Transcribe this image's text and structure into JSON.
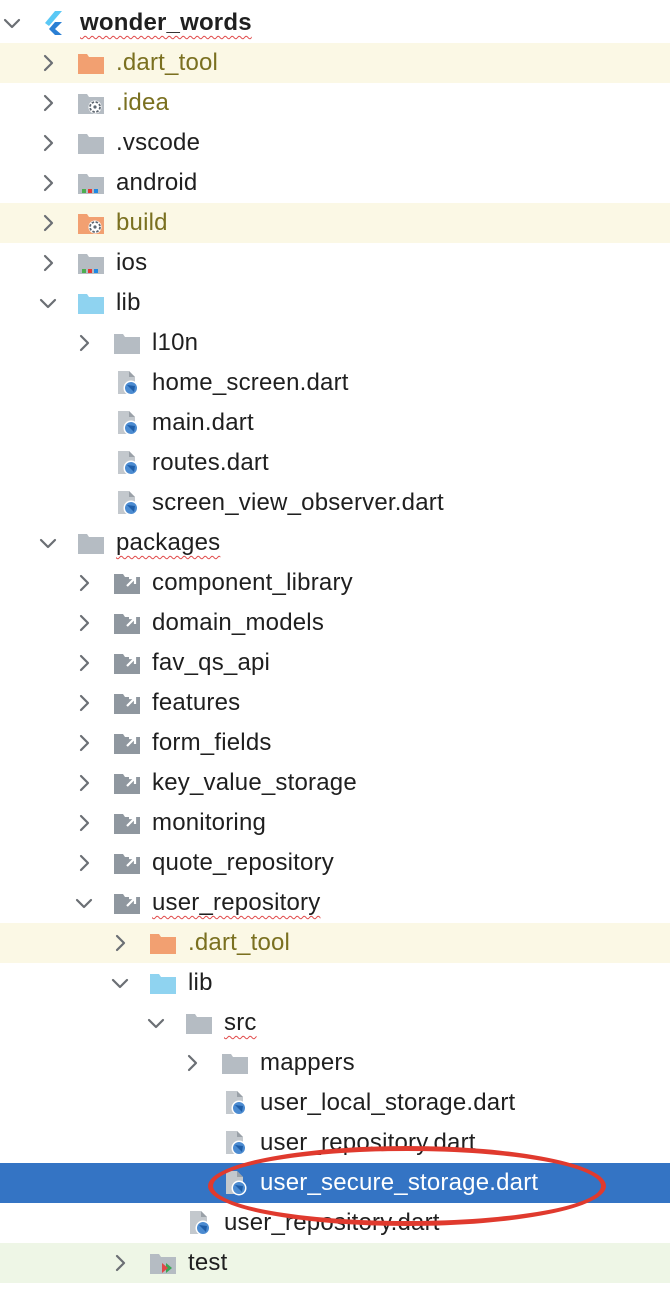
{
  "project": {
    "name": "wonder_words",
    "icon": "flutter-icon"
  },
  "colors": {
    "selection": "#3474c4",
    "ignored_row": "#fbf8e5",
    "ignored_text": "#7a7020",
    "test_row": "#eef6e6",
    "highlight_oval": "#e03a2e",
    "excluded_folder": "#f2a071",
    "source_folder": "#8fd3f0",
    "plain_folder": "#b5bcc3"
  },
  "tree": [
    {
      "label": "wonder_words",
      "icon": "flutter-icon",
      "depth": 0,
      "chevron": "down",
      "bold": true,
      "squiggle": true
    },
    {
      "label": ".dart_tool",
      "icon": "excluded-folder-icon",
      "depth": 1,
      "chevron": "right",
      "state": "ignored"
    },
    {
      "label": ".idea",
      "icon": "settings-folder-icon",
      "depth": 1,
      "chevron": "right",
      "state": "ignored-text"
    },
    {
      "label": ".vscode",
      "icon": "folder-icon",
      "depth": 1,
      "chevron": "right"
    },
    {
      "label": "android",
      "icon": "module-folder-icon",
      "depth": 1,
      "chevron": "right"
    },
    {
      "label": "build",
      "icon": "excluded-settings-folder-icon",
      "depth": 1,
      "chevron": "right",
      "state": "ignored"
    },
    {
      "label": "ios",
      "icon": "module-folder-icon",
      "depth": 1,
      "chevron": "right"
    },
    {
      "label": "lib",
      "icon": "source-folder-icon",
      "depth": 1,
      "chevron": "down"
    },
    {
      "label": "l10n",
      "icon": "folder-icon",
      "depth": 2,
      "chevron": "right"
    },
    {
      "label": "home_screen.dart",
      "icon": "dart-file-icon",
      "depth": 2,
      "chevron": "none"
    },
    {
      "label": "main.dart",
      "icon": "dart-file-icon",
      "depth": 2,
      "chevron": "none"
    },
    {
      "label": "routes.dart",
      "icon": "dart-file-icon",
      "depth": 2,
      "chevron": "none"
    },
    {
      "label": "screen_view_observer.dart",
      "icon": "dart-file-icon",
      "depth": 2,
      "chevron": "none"
    },
    {
      "label": "packages",
      "icon": "folder-icon",
      "depth": 1,
      "chevron": "down",
      "squiggle": true
    },
    {
      "label": "component_library",
      "icon": "linked-module-icon",
      "depth": 2,
      "chevron": "right"
    },
    {
      "label": "domain_models",
      "icon": "linked-module-icon",
      "depth": 2,
      "chevron": "right"
    },
    {
      "label": "fav_qs_api",
      "icon": "linked-module-icon",
      "depth": 2,
      "chevron": "right"
    },
    {
      "label": "features",
      "icon": "linked-module-icon",
      "depth": 2,
      "chevron": "right"
    },
    {
      "label": "form_fields",
      "icon": "linked-module-icon",
      "depth": 2,
      "chevron": "right"
    },
    {
      "label": "key_value_storage",
      "icon": "linked-module-icon",
      "depth": 2,
      "chevron": "right"
    },
    {
      "label": "monitoring",
      "icon": "linked-module-icon",
      "depth": 2,
      "chevron": "right"
    },
    {
      "label": "quote_repository",
      "icon": "linked-module-icon",
      "depth": 2,
      "chevron": "right"
    },
    {
      "label": "user_repository",
      "icon": "linked-module-icon",
      "depth": 2,
      "chevron": "down",
      "squiggle": true
    },
    {
      "label": ".dart_tool",
      "icon": "excluded-folder-icon",
      "depth": 3,
      "chevron": "right",
      "state": "ignored"
    },
    {
      "label": "lib",
      "icon": "source-folder-icon",
      "depth": 3,
      "chevron": "down"
    },
    {
      "label": "src",
      "icon": "folder-icon",
      "depth": 4,
      "chevron": "down",
      "squiggle": true
    },
    {
      "label": "mappers",
      "icon": "folder-icon",
      "depth": 5,
      "chevron": "right"
    },
    {
      "label": "user_local_storage.dart",
      "icon": "dart-file-icon",
      "depth": 5,
      "chevron": "none"
    },
    {
      "label": "user_repository.dart",
      "icon": "dart-file-icon",
      "depth": 5,
      "chevron": "none"
    },
    {
      "label": "user_secure_storage.dart",
      "icon": "dart-file-icon",
      "depth": 5,
      "chevron": "none",
      "state": "selected"
    },
    {
      "label": "user_repository.dart",
      "icon": "dart-file-icon",
      "depth": 4,
      "chevron": "none"
    },
    {
      "label": "test",
      "icon": "test-folder-icon",
      "depth": 3,
      "chevron": "right",
      "state": "test"
    }
  ]
}
